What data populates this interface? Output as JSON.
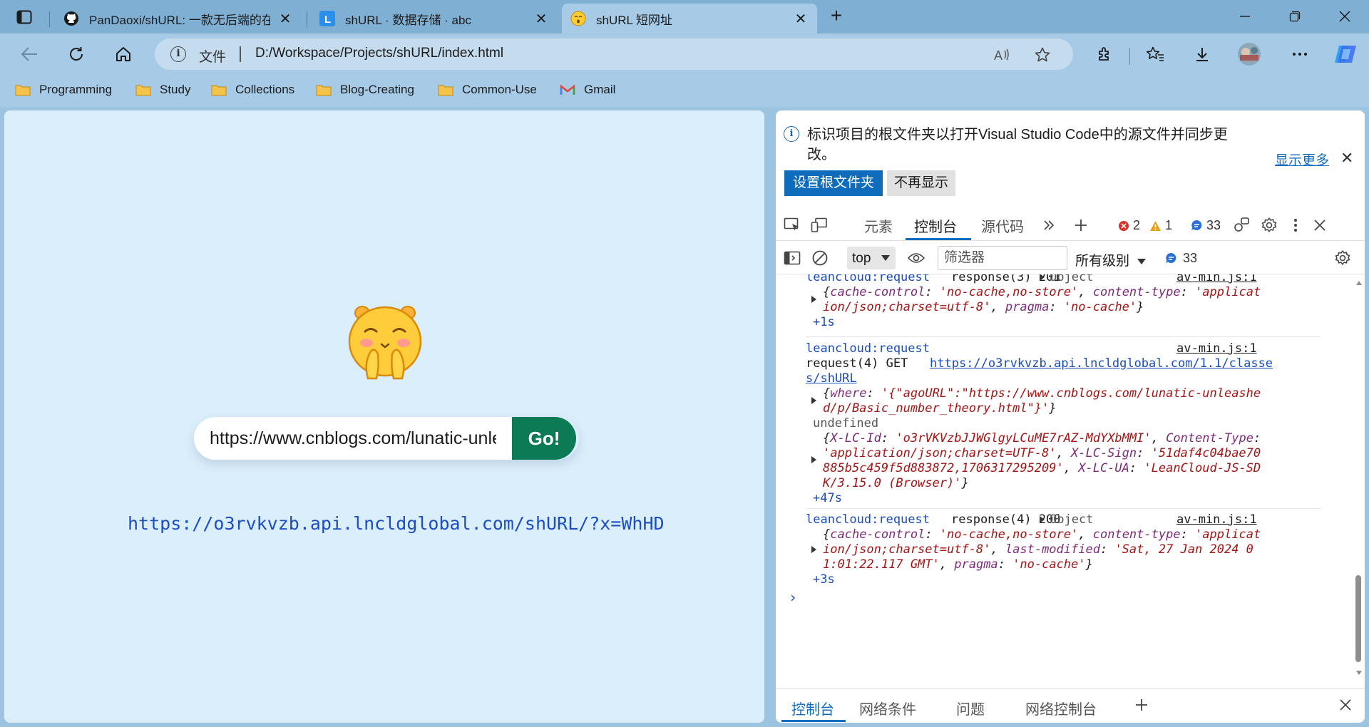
{
  "tabs": [
    {
      "title": "PanDaoxi/shURL: 一款无后端的在",
      "favicon": "github-icon"
    },
    {
      "title": "shURL · 数据存储 · abc",
      "favicon": "leancloud-icon"
    },
    {
      "title": "shURL 短网址",
      "favicon": "emoji-favicon-icon"
    }
  ],
  "address_bar": {
    "file_label": "文件",
    "url": "D:/Workspace/Projects/shURL/index.html"
  },
  "bookmarks": [
    {
      "label": "Programming",
      "icon": "folder-icon"
    },
    {
      "label": "Study",
      "icon": "folder-icon"
    },
    {
      "label": "Collections",
      "icon": "folder-icon"
    },
    {
      "label": "Blog-Creating",
      "icon": "folder-icon"
    },
    {
      "label": "Common-Use",
      "icon": "folder-icon"
    },
    {
      "label": "Gmail",
      "icon": "gmail-icon"
    }
  ],
  "page": {
    "input_value": "https://www.cnblogs.com/lunatic-unleashed/p/Basic_number_theory.html",
    "go_label": "Go!",
    "short_link": "https://o3rvkvzb.api.lncldglobal.com/shURL/?x=WhHD"
  },
  "devtools": {
    "info_text": "标识项目的根文件夹以打开Visual Studio Code中的源文件并同步更改。",
    "show_more": "显示更多",
    "set_root_button": "设置根文件夹",
    "dont_show_button": "不再显示",
    "tabs": [
      "元素",
      "控制台",
      "源代码"
    ],
    "errors": "2",
    "warnings": "1",
    "messages": "33",
    "context": "top",
    "filter_placeholder": "筛选器",
    "levels": "所有级别",
    "toolbar_messages": "33",
    "logs": {
      "r3_head": "leancloud:request",
      "r3_text": "response(3) 201",
      "r3_obj": "Object",
      "r3_src": "av-min.js:1",
      "r3_time": "+1s",
      "r4_head": "leancloud:request",
      "r4_src": "av-min.js:1",
      "r4_text": "request(4) GET",
      "r4_url1": "https://o3rvkvzb.api.lncldglobal.com/1.1/classe",
      "r4_url2": "s/shURL",
      "r4_undefined": "undefined",
      "r4_time": "+47s",
      "r5_head": "leancloud:request",
      "r5_text": "response(4) 200",
      "r5_obj": "Object",
      "r5_src": "av-min.js:1",
      "r5_time": "+3s"
    },
    "drawer_tabs": [
      "控制台",
      "网络条件",
      "问题",
      "网络控制台"
    ]
  }
}
